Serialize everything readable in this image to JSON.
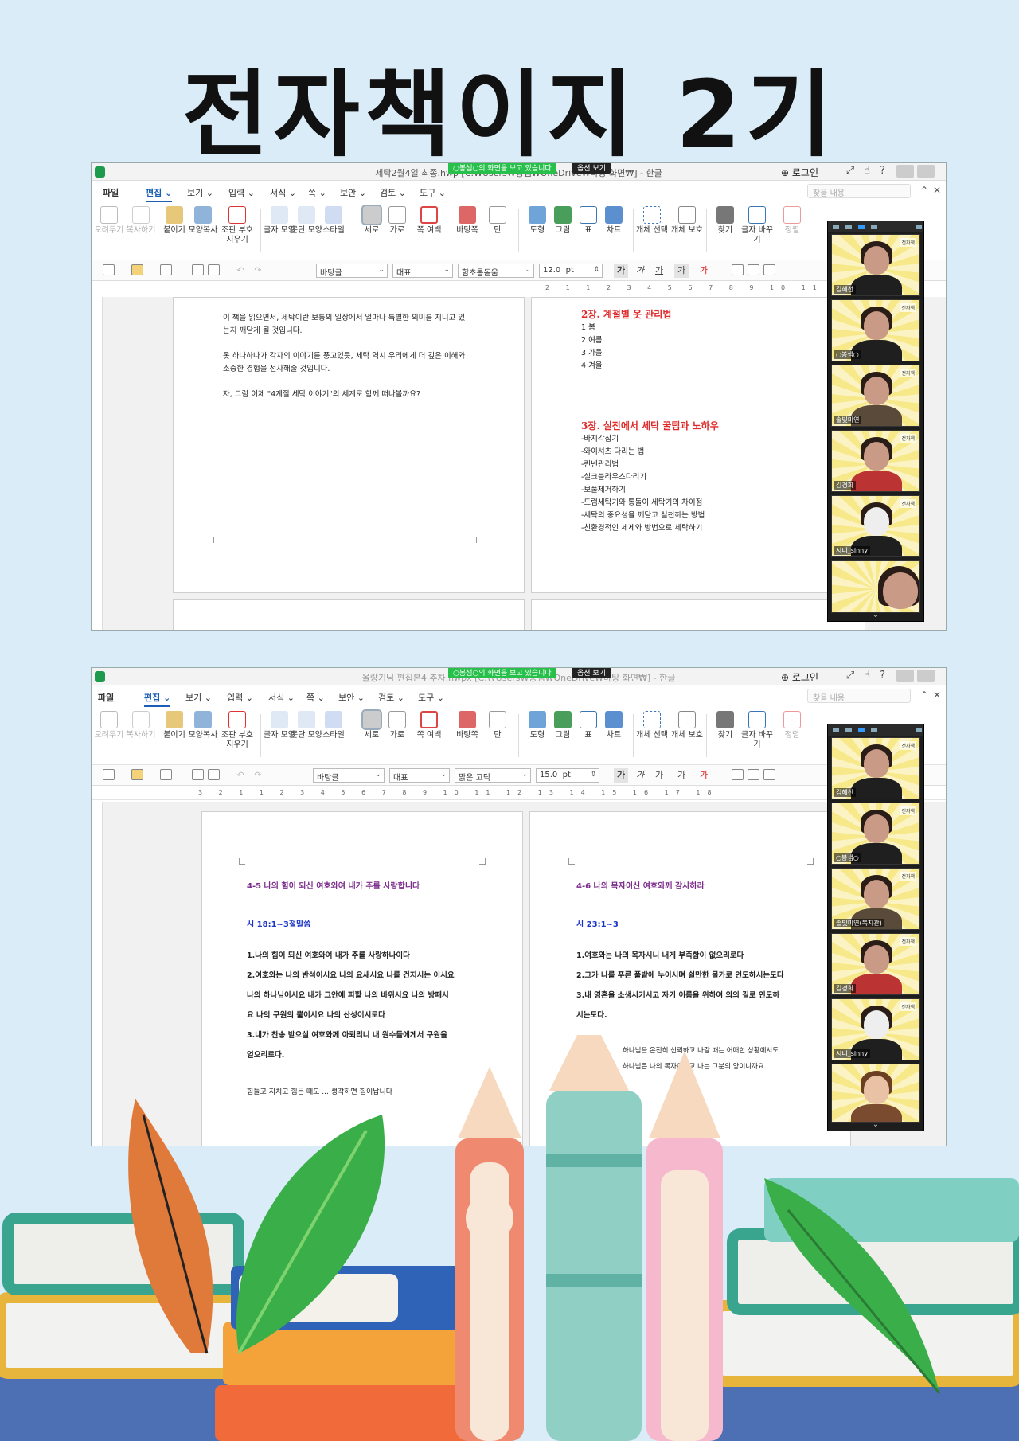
{
  "poster": {
    "title": "전자책이지 2기"
  },
  "screens": [
    {
      "titlebar": {
        "doc_title": "세탁2월4일 최종.hwp [C:₩Users₩봉샘₩OneDrive₩바탕 화면₩] - 한글",
        "share_notice": "○봉샘○의 화면을 보고 있습니다",
        "view_options": "옵션 보기",
        "login": "로그인"
      },
      "menu": {
        "items": [
          "파일",
          "편집",
          "보기",
          "입력",
          "서식",
          "쪽",
          "보안",
          "검토",
          "도구"
        ],
        "active": "편집",
        "search_placeholder": "찾을 내용"
      },
      "ribbon": [
        "오려두기",
        "복사하기",
        "붙이기",
        "모양복사",
        "조판 부호 지우기",
        "글자 모양",
        "문단 모양",
        "스타일",
        "세로",
        "가로",
        "쪽 여백",
        "바탕쪽",
        "단",
        "도형",
        "그림",
        "표",
        "차트",
        "개체 선택",
        "개체 보호",
        "찾기",
        "글자 바꾸기",
        "정렬"
      ],
      "format": {
        "style": "바탕글",
        "lang": "대표",
        "font": "함초롬돋움",
        "size": "12.0",
        "unit": "pt"
      },
      "ruler": "2 1 1 2 3 4 5 6 7 8 9 10 11 12 13 14",
      "left_page": [
        "이 책을 읽으면서, 세탁이란 보통의 일상에서 얼마나 특별한 의미를 지니고 있",
        "는지 깨닫게 될 것입니다.",
        "",
        "옷 하나하나가 각자의 이야기를 풍고있듯, 세탁 역시 우리에게 더 깊은 이해와",
        "소중한 경험을 선사해줄 것입니다.",
        "",
        "자, 그럼 이제 \"4계절 세탁 이야기\"의 세계로 함께 떠나볼까요?"
      ],
      "right_page": {
        "ch2_title": "2장. 계절별 옷 관리법",
        "ch2_items": [
          "1 봄",
          "2 여름",
          "3 가을",
          "4 겨울"
        ],
        "ch3_title": "3장. 실전에서 세탁 꿀팁과 노하우",
        "ch3_items": [
          "-바지각잡기",
          "-와이셔츠 다리는 법",
          "-린넨관리법",
          "-실크블라우스다리기",
          "-보풀제거하기",
          "-드럼세탁기와 통돌이 세탁기의 차이점",
          "-세탁의 중요성을 깨닫고 실천하는 방법",
          "-친환경적인 세제와 방법으로 세탁하기"
        ]
      },
      "participants": [
        "김혜선",
        "○봉샘○",
        "솔빛미연",
        "김경희",
        "시니_sinny",
        ""
      ]
    },
    {
      "titlebar": {
        "doc_title": "올랑기님 편집본4 추차.hwpx [C:₩Users₩봉샘₩OneDrive₩바탕 화면₩] - 한글",
        "share_notice": "○봉샘○의 화면을 보고 있습니다",
        "view_options": "옵션 보기",
        "login": "로그인"
      },
      "menu": {
        "items": [
          "파일",
          "편집",
          "보기",
          "입력",
          "서식",
          "쪽",
          "보안",
          "검토",
          "도구"
        ],
        "active": "편집",
        "search_placeholder": "찾을 내용"
      },
      "ribbon": [
        "오려두기",
        "복사하기",
        "붙이기",
        "모양복사",
        "조판 부호 지우기",
        "글자 모양",
        "문단 모양",
        "스타일",
        "세로",
        "가로",
        "쪽 여백",
        "바탕쪽",
        "단",
        "도형",
        "그림",
        "표",
        "차트",
        "개체 선택",
        "개체 보호",
        "찾기",
        "글자 바꾸기",
        "정렬"
      ],
      "format": {
        "style": "바탕글",
        "lang": "대표",
        "font": "맑은 고딕",
        "size": "15.0",
        "unit": "pt"
      },
      "ruler": "3 2 1 1 2 3 4 5 6 7 8 9 10 11 12 13 14 15 16 17 18",
      "left_page": {
        "heading": "4-5 나의 힘이 되신 여호와여 내가 주를 사랑합니다",
        "verse": "시 18:1~3절말씀",
        "lines": [
          "1.나의 힘이 되신 여호와여 내가 주를 사랑하나이다",
          "2.여호와는 나의 반석이시요 나의 요새시요 나를 건지시는 이시요",
          "나의 하나님이시요 내가 그안에 피할 나의 바위시요 나의 방패시",
          "요 나의 구원의 뿔이시요 나의 산성이시로다",
          "3.내가 찬송 받으실 여호와께 아뢰리니 내 원수들에게서 구원을",
          "얻으리로다."
        ],
        "footer": "힘들고 지치고 힘든 때도 ...         생각하면 힘이납니다"
      },
      "right_page": {
        "heading": "4-6 나의 목자이신 여호와께 감사하라",
        "verse": "시 23:1~3",
        "lines": [
          "1.여호와는 나의 목자시니 내게 부족함이 없으리로다",
          "2.그가 나를 푸른 풀밭에 누이시며 쉴만한 물가로 인도하시는도다",
          "3.내 영혼을 소생시키시고 자기 이름을 위하여 의의 길로 인도하",
          "시는도다."
        ],
        "tail": [
          "하나님을 온전히 신뢰하고 나갈 때는 어떠한 상황에서도",
          "하나님은 나의 목자이시고 나는 그분의 양이니까요."
        ]
      },
      "participants": [
        "김혜선",
        "○봉샘○",
        "솔빛미연(복지관)",
        "김경희",
        "시니_sinny",
        ""
      ]
    }
  ]
}
